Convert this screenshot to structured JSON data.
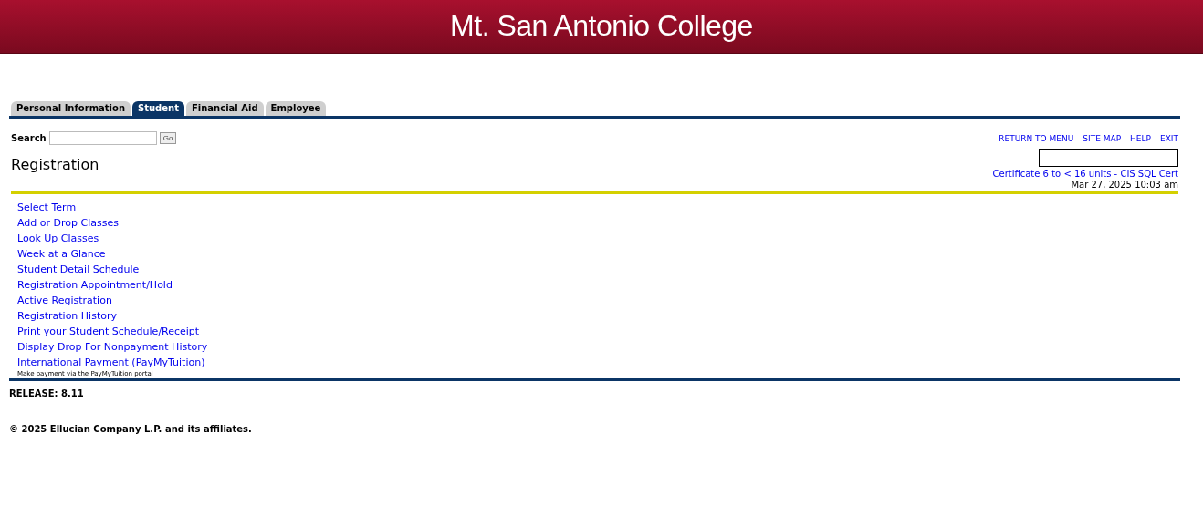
{
  "header": {
    "title": "Mt. San Antonio College"
  },
  "tabs": [
    {
      "label": "Personal Information",
      "selected": false
    },
    {
      "label": "Student",
      "selected": true
    },
    {
      "label": "Financial Aid",
      "selected": false
    },
    {
      "label": "Employee",
      "selected": false
    }
  ],
  "search": {
    "label": "Search",
    "button": "Go"
  },
  "nav_links": [
    "RETURN TO MENU",
    "SITE MAP",
    "HELP",
    "EXIT"
  ],
  "page_title": "Registration",
  "program_link": "Certificate 6 to < 16 units - CIS SQL Cert",
  "timestamp": "Mar 27, 2025 10:03 am",
  "menu": [
    {
      "label": "Select Term"
    },
    {
      "label": "Add or Drop Classes"
    },
    {
      "label": "Look Up Classes"
    },
    {
      "label": "Week at a Glance"
    },
    {
      "label": "Student Detail Schedule"
    },
    {
      "label": "Registration Appointment/Hold"
    },
    {
      "label": "Active Registration"
    },
    {
      "label": "Registration History"
    },
    {
      "label": "Print your Student Schedule/Receipt"
    },
    {
      "label": "Display Drop For Nonpayment History"
    },
    {
      "label": "International Payment (PayMyTuition)",
      "description": "Make payment via the PayMyTuition portal"
    }
  ],
  "release": "RELEASE: 8.11",
  "copyright": "© 2025 Ellucian Company L.P. and its affiliates."
}
